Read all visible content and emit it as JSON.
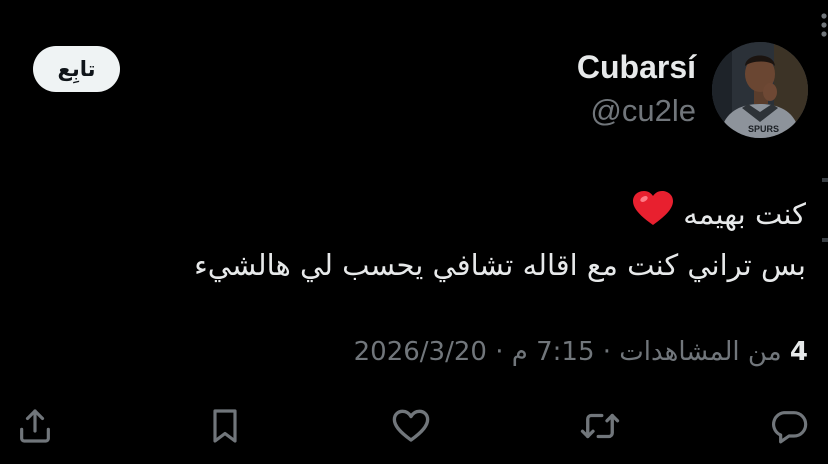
{
  "author": {
    "display_name": "Cubarsí",
    "handle": "@cu2le",
    "avatar_jersey_text": "SPURS"
  },
  "follow_button": {
    "label": "تابِع"
  },
  "post": {
    "line1": "كنت بهيمه",
    "line1_emoji": "heart-emoji",
    "line2": "بس تراني كنت مع اقاله تشافي يحسب لي هالشيء"
  },
  "meta": {
    "date": "2026/3/20",
    "separator": "·",
    "time": "7:15 م",
    "views_count": "4",
    "views_label": "من المشاهدات"
  },
  "actions": [
    {
      "icon": "reply-icon"
    },
    {
      "icon": "retweet-icon"
    },
    {
      "icon": "like-icon"
    },
    {
      "icon": "bookmark-icon"
    },
    {
      "icon": "share-icon"
    }
  ],
  "colors": {
    "background": "#000000",
    "primary_text": "#e7e9ea",
    "secondary_text": "#71767b",
    "follow_bg": "#eff3f4",
    "heart": "#f91880"
  }
}
